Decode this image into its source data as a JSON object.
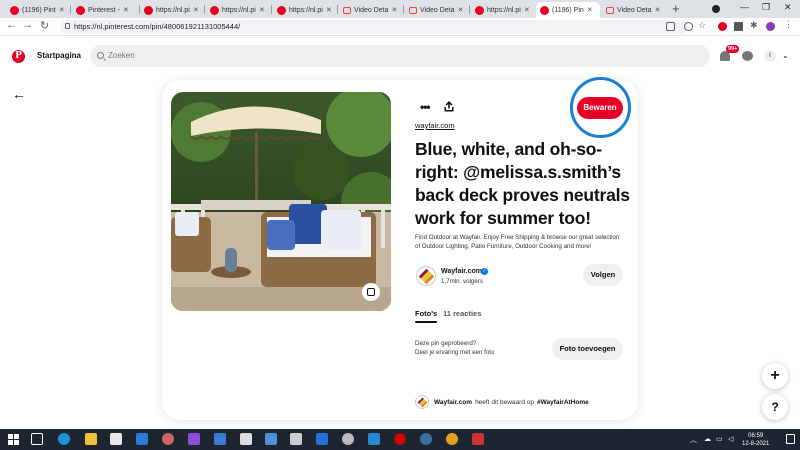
{
  "browser": {
    "tabs": [
      {
        "label": "(1196) Pint",
        "icon": "pinterest-icon",
        "active": false
      },
      {
        "label": "Pinterest - ",
        "icon": "pinterest-icon",
        "active": false
      },
      {
        "label": "https://nl.pi",
        "icon": "pinterest-icon",
        "active": false
      },
      {
        "label": "https://nl.pi",
        "icon": "pinterest-icon",
        "active": false
      },
      {
        "label": "https://nl.pi",
        "icon": "pinterest-icon",
        "active": false
      },
      {
        "label": "Video Deta",
        "icon": "video-icon",
        "active": false
      },
      {
        "label": "Video Deta",
        "icon": "video-icon",
        "active": false
      },
      {
        "label": "https://nl.pi",
        "icon": "pinterest-icon",
        "active": false
      },
      {
        "label": "(1196) Pin",
        "icon": "pinterest-icon",
        "active": true
      },
      {
        "label": "Video Deta",
        "icon": "video-icon",
        "active": false
      }
    ],
    "url": "https://nl.pinterest.com/pin/480061921131005444/"
  },
  "header": {
    "logo": "P",
    "home_label": "Startpagina",
    "search_placeholder": "Zoeken",
    "notification_count": "99+",
    "avatar_initial": "I"
  },
  "pin": {
    "domain": "wayfair.com",
    "save_label": "Bewaren",
    "title": "Blue, white, and oh-so-right: @melissa.s.smith’s back deck proves neutrals work for summer too!",
    "description": "Find Outdoor at Wayfair. Enjoy Free Shipping & browse our great selection of Outdoor Lighting, Patio Furniture, Outdoor Cooking and more!",
    "profile_name": "Wayfair.com",
    "followers": "1,7mln. volgers",
    "follow_label": "Volgen",
    "tab_photos": "Foto's",
    "tab_reactions": "11 reacties",
    "tried_line1": "Deze pin geprobeerd?",
    "tried_line2": "Deel je ervaring met een foto",
    "add_photo_label": "Foto toevoegen",
    "saved_by": "Wayfair.com",
    "saved_text": "heeft dit bewaard op",
    "saved_board": "#WayfairAtHome"
  },
  "fab": {
    "plus": "+",
    "help": "?"
  },
  "taskbar": {
    "time": "06:59",
    "date": "12-8-2021"
  },
  "colors": {
    "pinterest_red": "#e60023",
    "highlight_circle": "#1a7fd4"
  }
}
